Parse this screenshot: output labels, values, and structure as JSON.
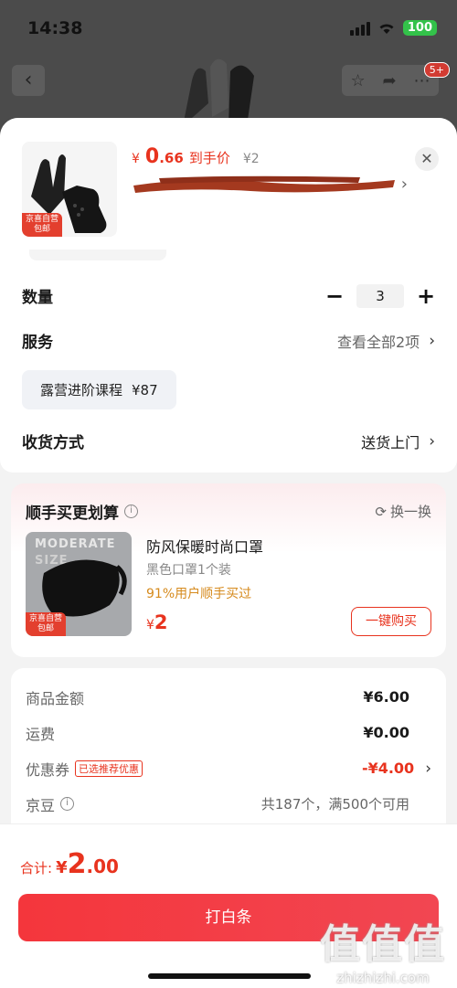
{
  "status_bar": {
    "time": "14:38",
    "battery": "100"
  },
  "background": {
    "cart_badge": "5+"
  },
  "product": {
    "tag_line1": "京喜自营",
    "tag_line2": "包邮",
    "price_currency": "¥",
    "price_int": "0",
    "price_dec": ".66",
    "price_label": "到手价",
    "original_price": "¥2"
  },
  "options": {
    "quantity_label": "数量",
    "quantity_value": "3",
    "minus": "−",
    "plus": "+",
    "service_label": "服务",
    "service_value": "查看全部2项",
    "course_name": "露营进阶课程",
    "course_price": "¥87",
    "delivery_label": "收货方式",
    "delivery_value": "送货上门"
  },
  "recommend": {
    "title": "顺手买更划算",
    "swap_label": "换一换",
    "img_text1": "MODERATE",
    "img_text2": "SIZE",
    "tag_line1": "京喜自营",
    "tag_line2": "包邮",
    "name": "防风保暖时尚口罩",
    "spec": "黑色口罩1个装",
    "stat": "91%用户顺手买过",
    "price_currency": "¥",
    "price_value": "2",
    "buy_label": "一键购买"
  },
  "summary": {
    "goods_label": "商品金额",
    "goods_value": "¥6.00",
    "shipping_label": "运费",
    "shipping_value": "¥0.00",
    "coupon_label": "优惠券",
    "coupon_badge": "已选推荐优惠",
    "coupon_value": "-¥4.00",
    "jd_label": "京豆",
    "jd_note": "共187个，满500个可用"
  },
  "footer": {
    "total_label": "合计:",
    "total_currency": "¥",
    "total_int": "2",
    "total_dec": ".00",
    "pay_label": "打白条",
    "watermark_main": "值值值",
    "watermark_sub": "zhizhizhi.com"
  },
  "colors": {
    "accent": "#e8331e",
    "pay_button": "#f4363c",
    "stat_orange": "#d68a1c"
  }
}
